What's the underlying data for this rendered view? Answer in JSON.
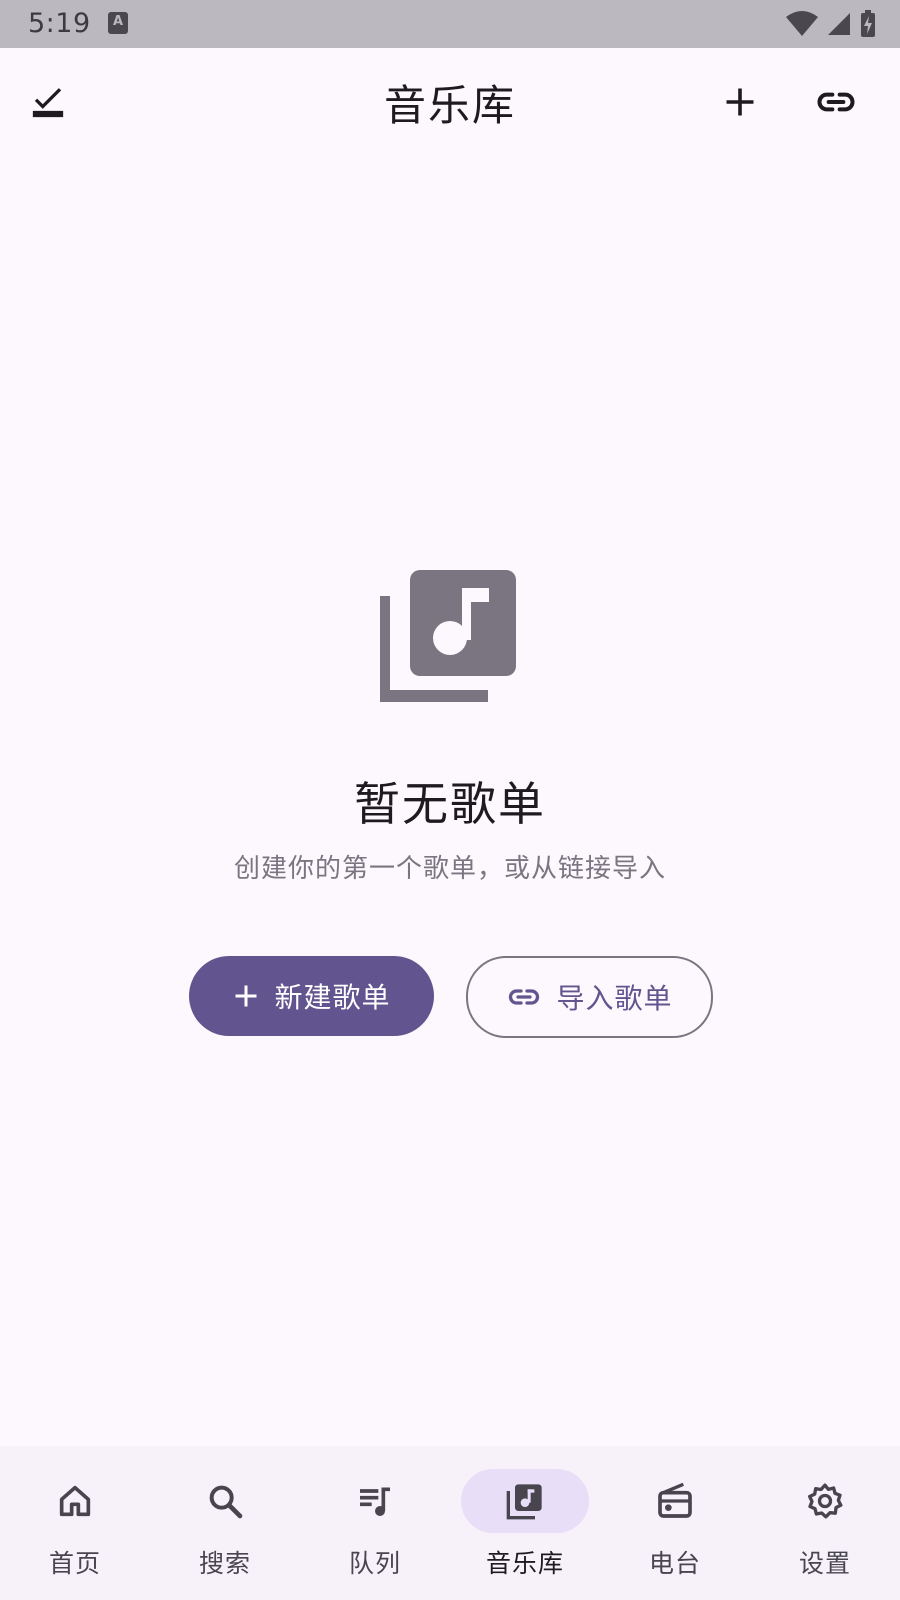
{
  "status_bar": {
    "time": "5:19",
    "notification_icon": "a-icon",
    "wifi_icon": "wifi-icon",
    "signal_icon": "signal-icon",
    "battery_icon": "battery-charging-icon"
  },
  "app_bar": {
    "title": "音乐库",
    "left_action": "select-check-icon",
    "right_actions": [
      "add-icon",
      "link-icon"
    ]
  },
  "empty_state": {
    "icon": "library-music-icon",
    "title": "暂无歌单",
    "subtitle": "创建你的第一个歌单，或从链接导入",
    "primary_button": {
      "label": "新建歌单",
      "icon": "add-icon"
    },
    "secondary_button": {
      "label": "导入歌单",
      "icon": "link-icon"
    }
  },
  "bottom_nav": {
    "items": [
      {
        "label": "首页",
        "icon": "home-icon",
        "active": false
      },
      {
        "label": "搜索",
        "icon": "search-icon",
        "active": false
      },
      {
        "label": "队列",
        "icon": "queue-music-icon",
        "active": false
      },
      {
        "label": "音乐库",
        "icon": "library-music-icon",
        "active": true
      },
      {
        "label": "电台",
        "icon": "radio-icon",
        "active": false
      },
      {
        "label": "设置",
        "icon": "settings-icon",
        "active": false
      }
    ]
  },
  "colors": {
    "background": "#fdf8fd",
    "primary": "#62548e",
    "active_indicator": "#e8def8",
    "status_bar": "#bcb8bf",
    "muted_text": "#7a7580"
  }
}
